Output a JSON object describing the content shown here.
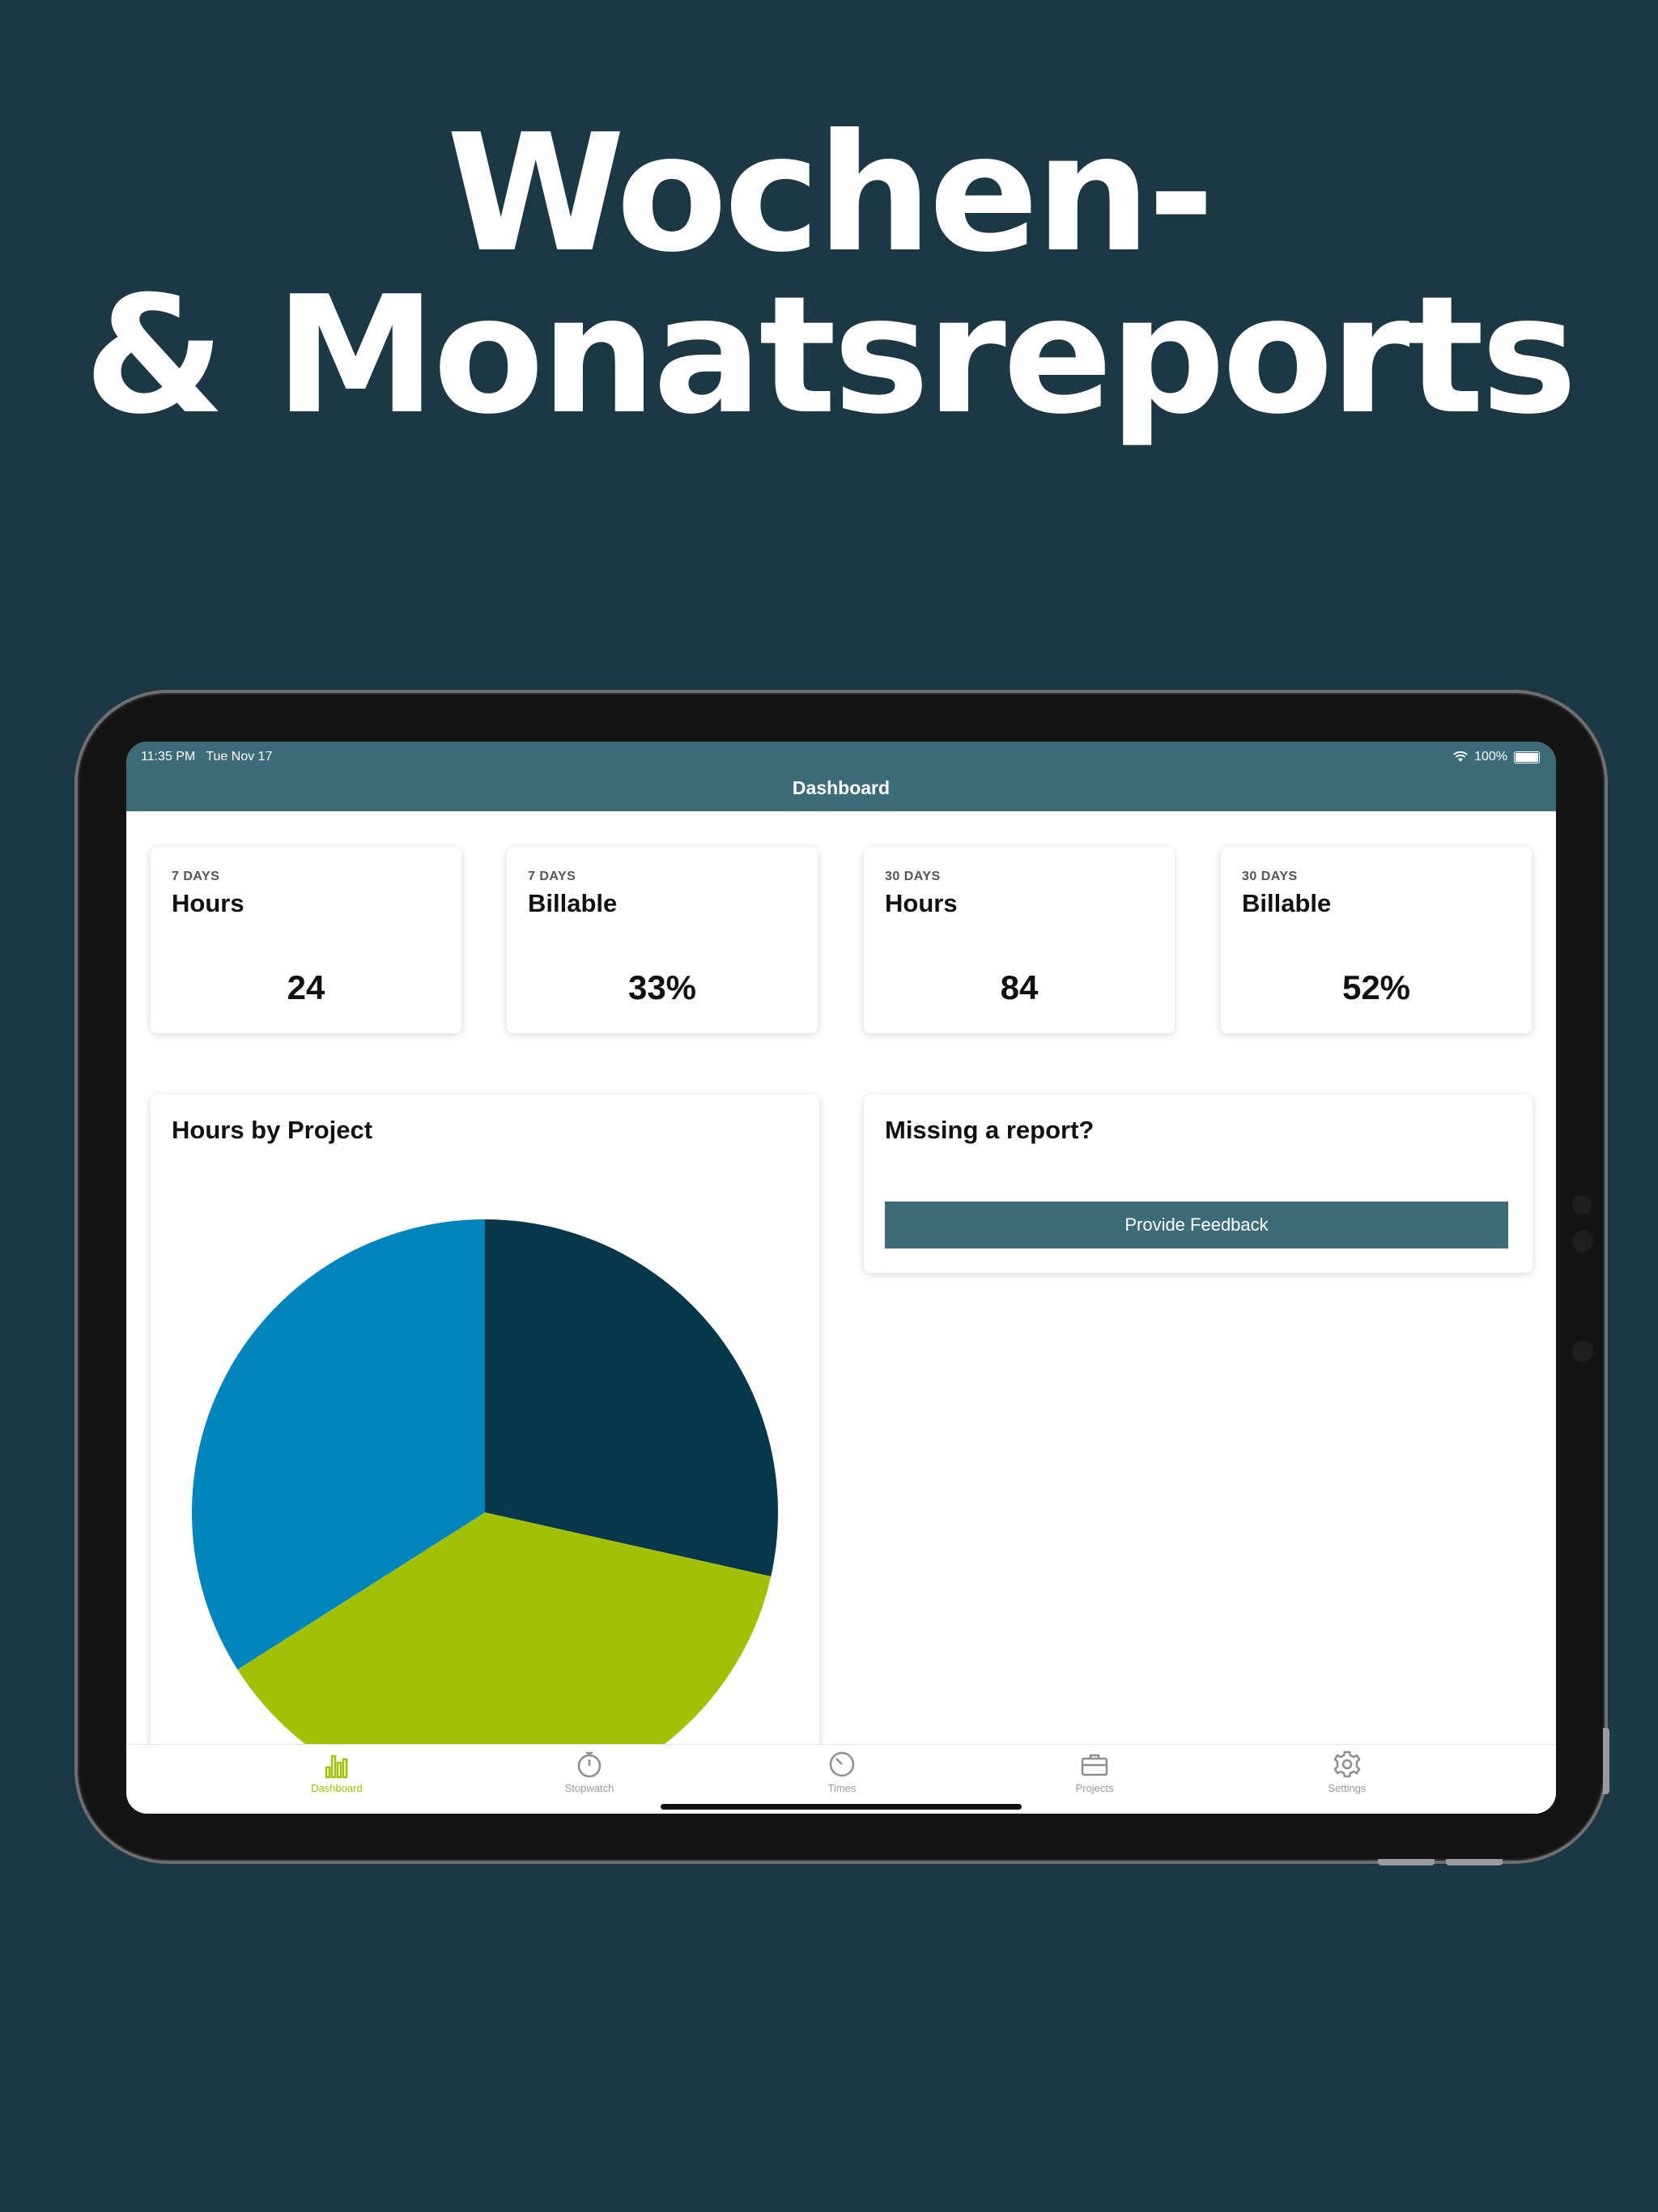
{
  "headline": {
    "line1": "Wochen-",
    "line2": "& Monatsreports"
  },
  "status_bar": {
    "time": "11:35 PM",
    "date": "Tue Nov 17",
    "battery": "100%"
  },
  "nav": {
    "title": "Dashboard"
  },
  "stats": [
    {
      "period": "7 DAYS",
      "label": "Hours",
      "value": "24"
    },
    {
      "period": "7 DAYS",
      "label": "Billable",
      "value": "33%"
    },
    {
      "period": "30 DAYS",
      "label": "Hours",
      "value": "84"
    },
    {
      "period": "30 DAYS",
      "label": "Billable",
      "value": "52%"
    }
  ],
  "chart_card": {
    "title": "Hours by Project"
  },
  "chart_data": {
    "type": "pie",
    "slices": [
      {
        "share": 0.285,
        "color": "#08374a"
      },
      {
        "share": 0.375,
        "color": "#a2c005"
      },
      {
        "share": 0.34,
        "color": "#0084bc"
      }
    ]
  },
  "feedback_card": {
    "title": "Missing a report?",
    "button_label": "Provide Feedback"
  },
  "tabs": [
    {
      "label": "Dashboard",
      "icon": "bar-chart-icon",
      "active": true,
      "active_color": "#a2c005"
    },
    {
      "label": "Stopwatch",
      "icon": "stopwatch-icon",
      "active": false
    },
    {
      "label": "Times",
      "icon": "gauge-icon",
      "active": false
    },
    {
      "label": "Projects",
      "icon": "briefcase-icon",
      "active": false
    },
    {
      "label": "Settings",
      "icon": "gear-icon",
      "active": false
    }
  ],
  "colors": {
    "background": "#1d3845",
    "accent": "#3d6b78",
    "active_tab": "#a2c005"
  }
}
